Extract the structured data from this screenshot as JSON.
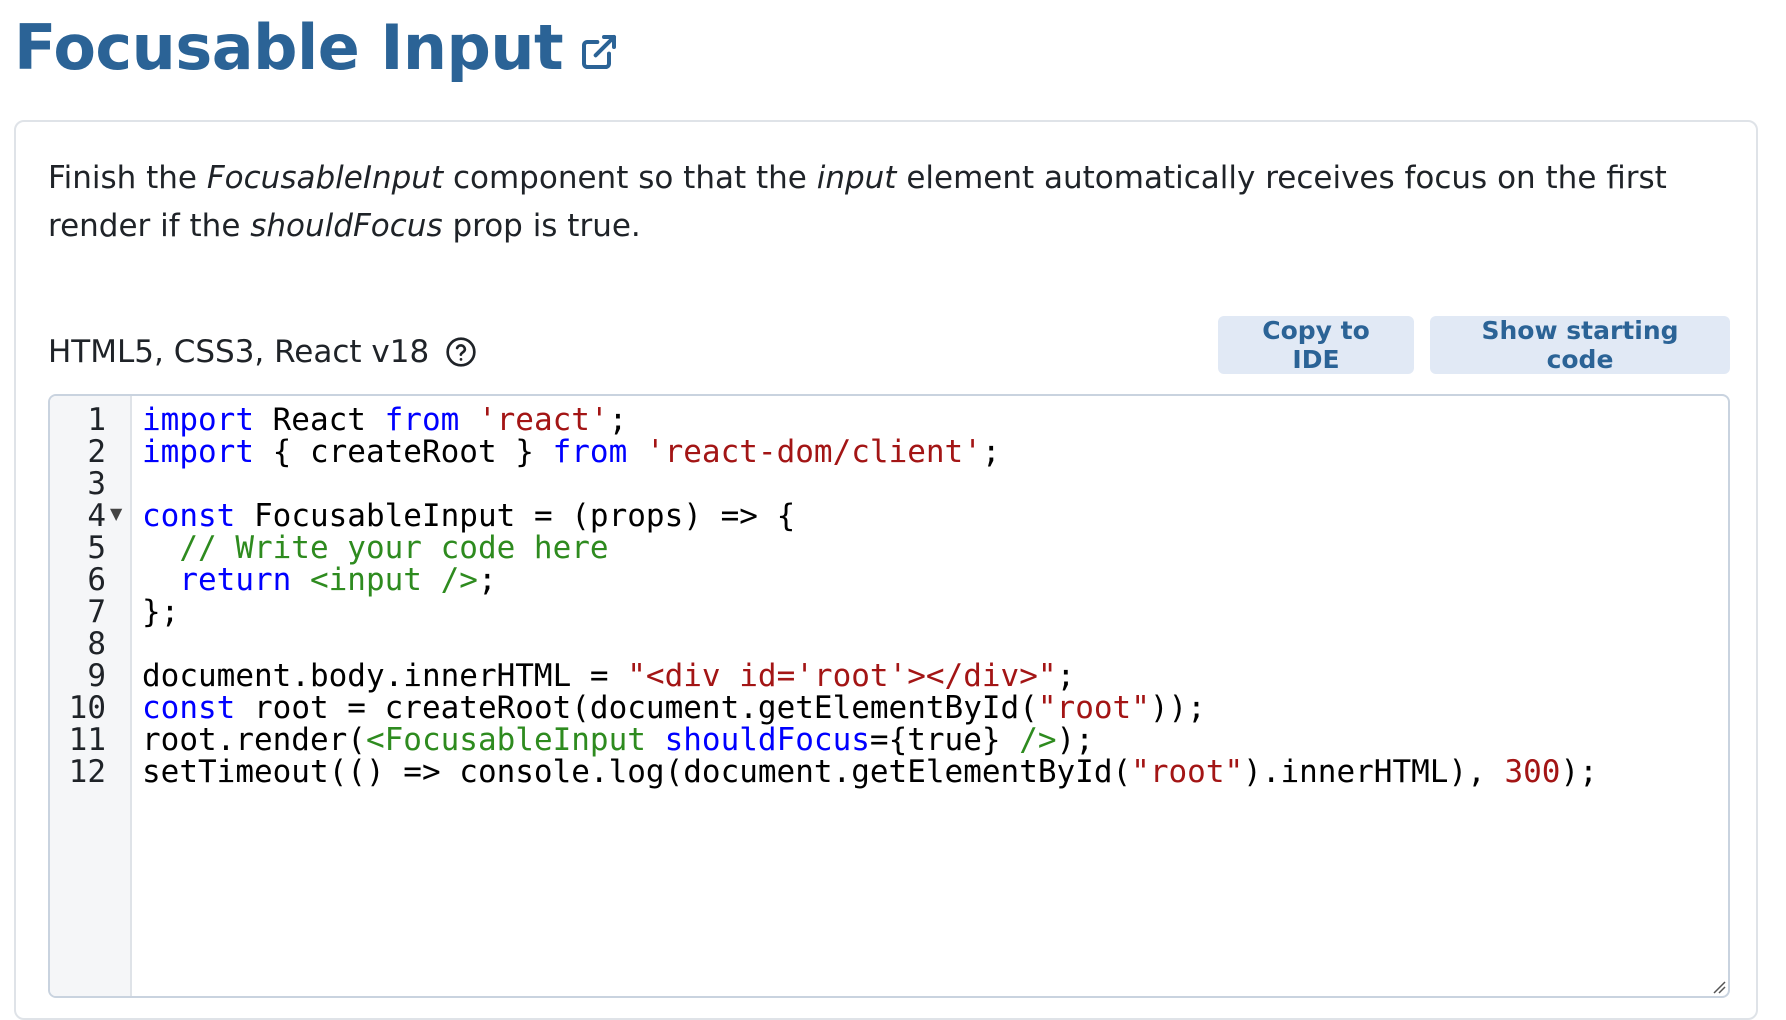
{
  "header": {
    "title": "Focusable Input",
    "external_link_icon": "external-link-icon"
  },
  "task": {
    "desc_part1": "Finish the ",
    "desc_component": "FocusableInput",
    "desc_part2": " component so that the ",
    "desc_element": "input",
    "desc_part3": " element automatically receives focus on the first render if the ",
    "desc_prop": "shouldFocus",
    "desc_part4": " prop is true."
  },
  "toolbar": {
    "tech_label": "HTML5, CSS3, React v18",
    "help_icon": "question-circle-icon",
    "copy_label": "Copy to IDE",
    "show_label": "Show starting code"
  },
  "editor": {
    "line_numbers": [
      "1",
      "2",
      "3",
      "4",
      "5",
      "6",
      "7",
      "8",
      "9",
      "10",
      "11",
      "12"
    ],
    "fold_marker": "▼",
    "lines": [
      [
        {
          "t": "import",
          "c": "kw"
        },
        {
          "t": " React ",
          "c": ""
        },
        {
          "t": "from",
          "c": "kw"
        },
        {
          "t": " ",
          "c": ""
        },
        {
          "t": "'react'",
          "c": "str"
        },
        {
          "t": ";",
          "c": ""
        }
      ],
      [
        {
          "t": "import",
          "c": "kw"
        },
        {
          "t": " { createRoot } ",
          "c": ""
        },
        {
          "t": "from",
          "c": "kw"
        },
        {
          "t": " ",
          "c": ""
        },
        {
          "t": "'react-dom/client'",
          "c": "str"
        },
        {
          "t": ";",
          "c": ""
        }
      ],
      [],
      [
        {
          "t": "const",
          "c": "kw"
        },
        {
          "t": " FocusableInput = (props) => {",
          "c": ""
        }
      ],
      [
        {
          "t": "  ",
          "c": ""
        },
        {
          "t": "// Write your code here",
          "c": "cmt"
        }
      ],
      [
        {
          "t": "  ",
          "c": ""
        },
        {
          "t": "return",
          "c": "kw"
        },
        {
          "t": " ",
          "c": ""
        },
        {
          "t": "<input />",
          "c": "tag"
        },
        {
          "t": ";",
          "c": ""
        }
      ],
      [
        {
          "t": "};",
          "c": ""
        }
      ],
      [],
      [
        {
          "t": "document.body.innerHTML = ",
          "c": ""
        },
        {
          "t": "\"<div id='root'></div>\"",
          "c": "str"
        },
        {
          "t": ";",
          "c": ""
        }
      ],
      [
        {
          "t": "const",
          "c": "kw"
        },
        {
          "t": " root = createRoot(document.getElementById(",
          "c": ""
        },
        {
          "t": "\"root\"",
          "c": "str"
        },
        {
          "t": "));",
          "c": ""
        }
      ],
      [
        {
          "t": "root.render(",
          "c": ""
        },
        {
          "t": "<FocusableInput ",
          "c": "tag"
        },
        {
          "t": "shouldFocus",
          "c": "attr"
        },
        {
          "t": "={true} ",
          "c": ""
        },
        {
          "t": "/>",
          "c": "tag"
        },
        {
          "t": ");",
          "c": ""
        }
      ],
      [
        {
          "t": "setTimeout(() => console.log(document.getElementById(",
          "c": ""
        },
        {
          "t": "\"root\"",
          "c": "str"
        },
        {
          "t": ").innerHTML), ",
          "c": ""
        },
        {
          "t": "300",
          "c": "num"
        },
        {
          "t": ");",
          "c": ""
        }
      ]
    ]
  }
}
